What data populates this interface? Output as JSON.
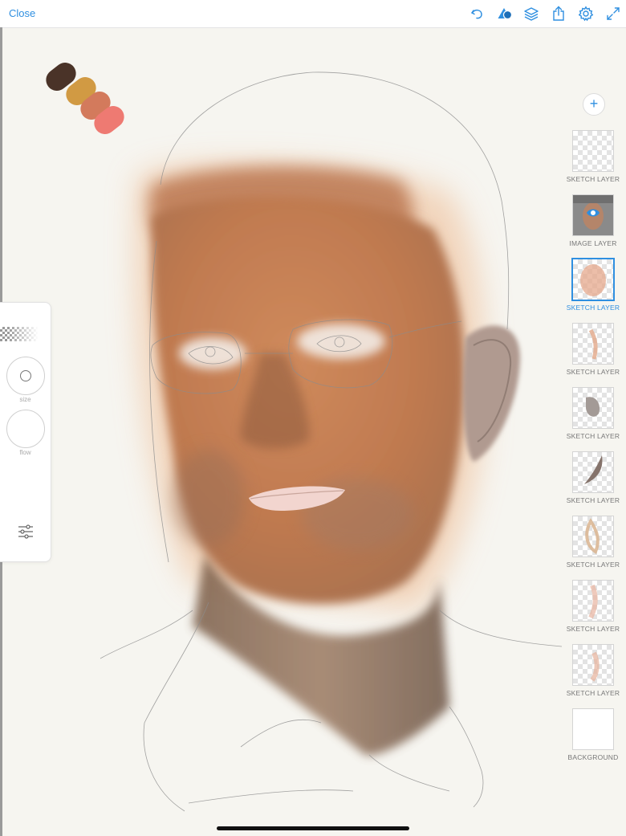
{
  "toolbar": {
    "close_label": "Close",
    "icons": [
      "undo-icon",
      "shape-icon",
      "layers-icon",
      "share-icon",
      "settings-icon",
      "expand-icon"
    ]
  },
  "colors": {
    "accent": "#2f8fe0",
    "swatches": [
      "#4a3328",
      "#d19a43",
      "#d37a5c",
      "#ee7a72"
    ]
  },
  "tools": {
    "size_label": "size",
    "flow_label": "flow"
  },
  "layers": [
    {
      "label": "SKETCH LAYER",
      "kind": "sketch",
      "selected": false
    },
    {
      "label": "IMAGE LAYER",
      "kind": "image",
      "selected": false
    },
    {
      "label": "SKETCH LAYER",
      "kind": "sketch",
      "selected": true
    },
    {
      "label": "SKETCH LAYER",
      "kind": "sketch",
      "selected": false
    },
    {
      "label": "SKETCH LAYER",
      "kind": "sketch",
      "selected": false
    },
    {
      "label": "SKETCH LAYER",
      "kind": "sketch",
      "selected": false
    },
    {
      "label": "SKETCH LAYER",
      "kind": "sketch",
      "selected": false
    },
    {
      "label": "SKETCH LAYER",
      "kind": "sketch",
      "selected": false
    },
    {
      "label": "SKETCH LAYER",
      "kind": "sketch",
      "selected": false
    },
    {
      "label": "BACKGROUND",
      "kind": "background",
      "selected": false
    }
  ]
}
